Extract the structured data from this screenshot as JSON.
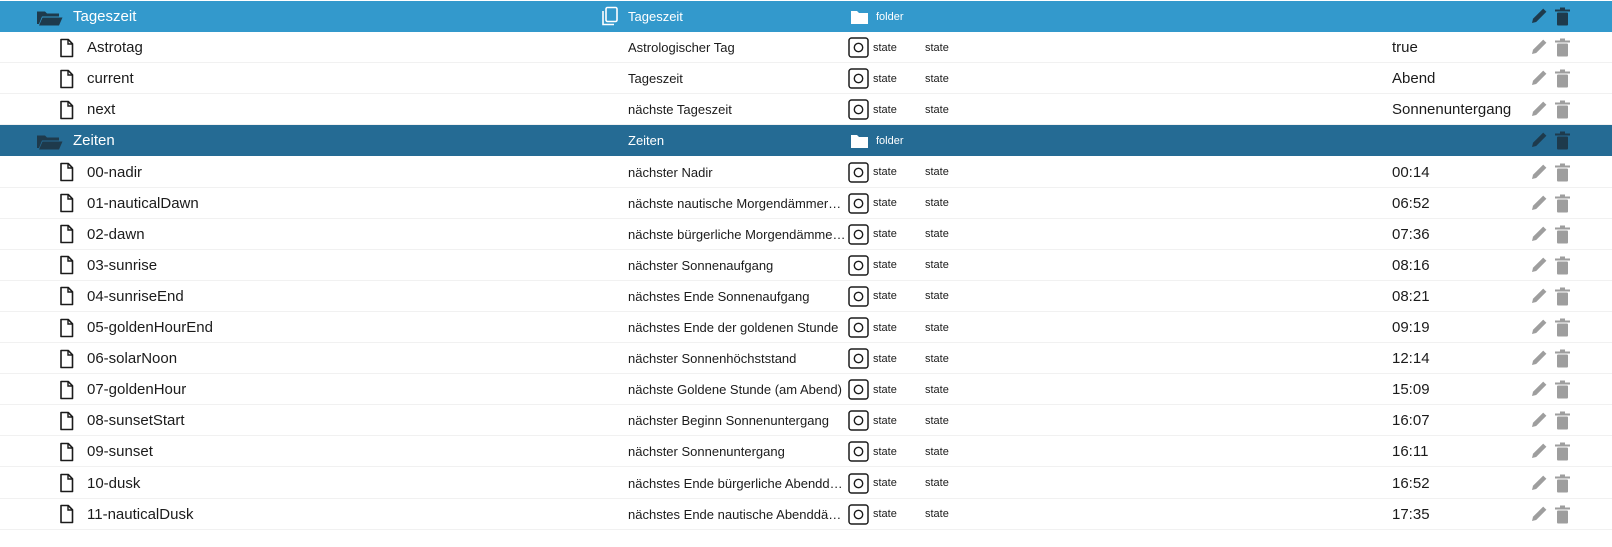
{
  "colors": {
    "folder_row_light": "#3399cc",
    "folder_row_dark": "#256b94",
    "action_icon_state": "#9e9e9e",
    "action_icon_folder": "#1e3a4c"
  },
  "rows": [
    {
      "kind": "folder",
      "variant": "light",
      "level": 0,
      "name": "Tageszeit",
      "description": "Tageszeit",
      "role_icon": "folder-icon",
      "role": "folder",
      "desc_icon": "copy-icon"
    },
    {
      "kind": "state",
      "level": 1,
      "name": "Astrotag",
      "description": "Astrologischer Tag",
      "role": "state",
      "type": "state",
      "value": "true"
    },
    {
      "kind": "state",
      "level": 1,
      "name": "current",
      "description": "Tageszeit",
      "role": "state",
      "type": "state",
      "value": "Abend"
    },
    {
      "kind": "state",
      "level": 1,
      "name": "next",
      "description": "nächste Tageszeit",
      "role": "state",
      "type": "state",
      "value": "Sonnenuntergang"
    },
    {
      "kind": "folder",
      "variant": "dark",
      "level": 0,
      "name": "Zeiten",
      "description": "Zeiten",
      "role_icon": "folder-icon",
      "role": "folder"
    },
    {
      "kind": "state",
      "level": 1,
      "name": "00-nadir",
      "description": "nächster Nadir",
      "role": "state",
      "type": "state",
      "value": "00:14"
    },
    {
      "kind": "state",
      "level": 1,
      "name": "01-nauticalDawn",
      "description": "nächste nautische Morgendämmerung",
      "role": "state",
      "type": "state",
      "value": "06:52"
    },
    {
      "kind": "state",
      "level": 1,
      "name": "02-dawn",
      "description": "nächste bürgerliche Morgendämmerung",
      "role": "state",
      "type": "state",
      "value": "07:36"
    },
    {
      "kind": "state",
      "level": 1,
      "name": "03-sunrise",
      "description": "nächster Sonnenaufgang",
      "role": "state",
      "type": "state",
      "value": "08:16"
    },
    {
      "kind": "state",
      "level": 1,
      "name": "04-sunriseEnd",
      "description": "nächstes Ende Sonnenaufgang",
      "role": "state",
      "type": "state",
      "value": "08:21"
    },
    {
      "kind": "state",
      "level": 1,
      "name": "05-goldenHourEnd",
      "description": "nächstes Ende der goldenen Stunde",
      "role": "state",
      "type": "state",
      "value": "09:19"
    },
    {
      "kind": "state",
      "level": 1,
      "name": "06-solarNoon",
      "description": "nächster Sonnenhöchststand",
      "role": "state",
      "type": "state",
      "value": "12:14"
    },
    {
      "kind": "state",
      "level": 1,
      "name": "07-goldenHour",
      "description": "nächste Goldene Stunde (am Abend)",
      "role": "state",
      "type": "state",
      "value": "15:09"
    },
    {
      "kind": "state",
      "level": 1,
      "name": "08-sunsetStart",
      "description": "nächster Beginn Sonnenuntergang",
      "role": "state",
      "type": "state",
      "value": "16:07"
    },
    {
      "kind": "state",
      "level": 1,
      "name": "09-sunset",
      "description": "nächster Sonnenuntergang",
      "role": "state",
      "type": "state",
      "value": "16:11"
    },
    {
      "kind": "state",
      "level": 1,
      "name": "10-dusk",
      "description": "nächstes Ende bürgerliche Abenddämmerung",
      "role": "state",
      "type": "state",
      "value": "16:52"
    },
    {
      "kind": "state",
      "level": 1,
      "name": "11-nauticalDusk",
      "description": "nächstes Ende nautische Abenddämmerung",
      "role": "state",
      "type": "state",
      "value": "17:35"
    }
  ]
}
